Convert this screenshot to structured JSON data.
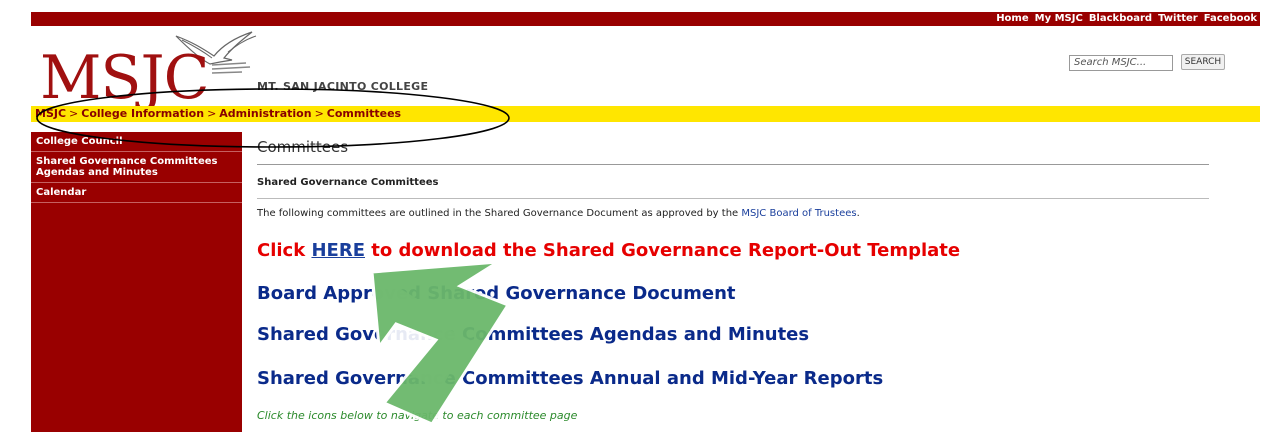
{
  "top_nav": [
    "Home",
    "My MSJC",
    "Blackboard",
    "Twitter",
    "Facebook"
  ],
  "header": {
    "logo_text": "MSJC",
    "college_name": "MT. SAN JACINTO COLLEGE"
  },
  "search": {
    "placeholder": "Search MSJC...",
    "button_label": "SEARCH"
  },
  "breadcrumb": [
    "MSJC",
    "College Information",
    "Administration",
    "Committees"
  ],
  "breadcrumb_separator": ">",
  "sidebar": {
    "items": [
      {
        "label": "College Council"
      },
      {
        "label": "Shared Governance Committees Agendas and Minutes"
      },
      {
        "label": "Calendar"
      }
    ]
  },
  "main": {
    "title": "Committees",
    "subheading": "Shared Governance Committees",
    "intro_text": "The following committees are outlined in the Shared Governance Document as approved by the ",
    "intro_link": "MSJC Board of Trustees",
    "intro_end": ".",
    "download_prefix": "Click ",
    "download_link": "HERE",
    "download_suffix": " to download the Shared Governance Report-Out Template",
    "link1": "Board Approved Shared Governance Document",
    "link2": "Shared Governance Committees Agendas and Minutes",
    "link3": "Shared Governance Committees Annual and Mid-Year Reports",
    "note": "Click the icons below to navigate to each committee page"
  },
  "colors": {
    "brand_red": "#990000",
    "breadcrumb_yellow": "#ffe600",
    "link_blue": "#0a2a8a",
    "alert_red": "#e60000",
    "arrow_green": "#6bb86b"
  }
}
